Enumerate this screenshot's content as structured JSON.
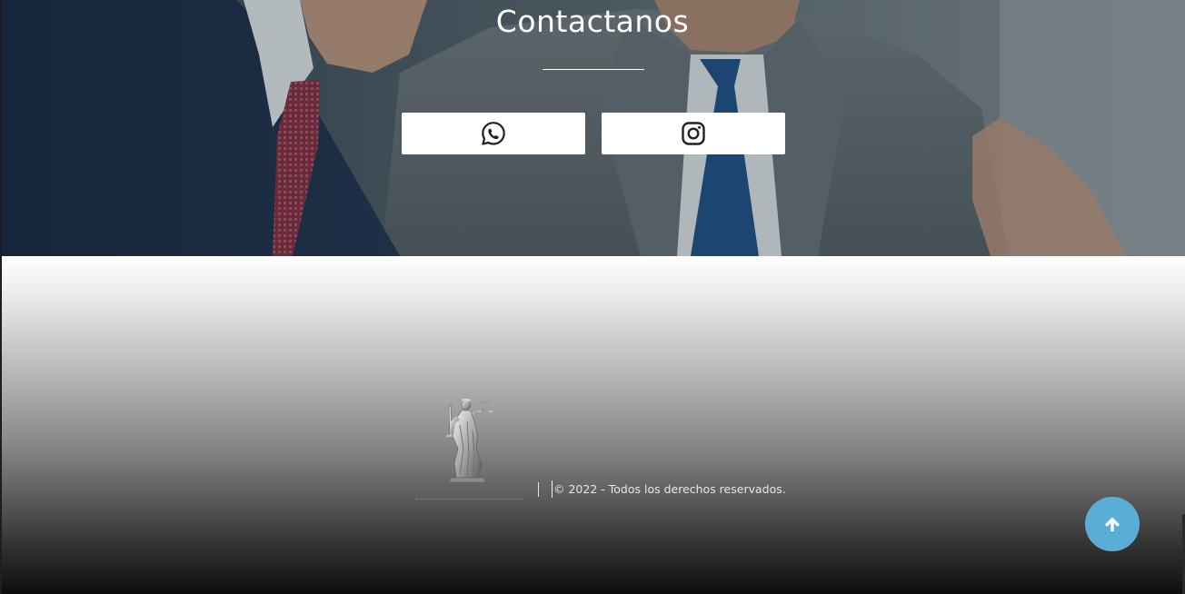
{
  "contact": {
    "title": "Contactanos",
    "buttons": [
      {
        "network": "WhatsApp",
        "icon": "whatsapp-icon"
      },
      {
        "network": "Instagram",
        "icon": "instagram-icon"
      }
    ]
  },
  "footer": {
    "logo_icon": "lady-justice-statue-icon",
    "copyright": "© 2022 - Todos los derechos reservados.",
    "scroll_top_icon": "arrow-up-icon"
  },
  "colors": {
    "accent": "#5aaed6",
    "button_bg": "#ffffff",
    "text_light": "#e6e6e6"
  }
}
